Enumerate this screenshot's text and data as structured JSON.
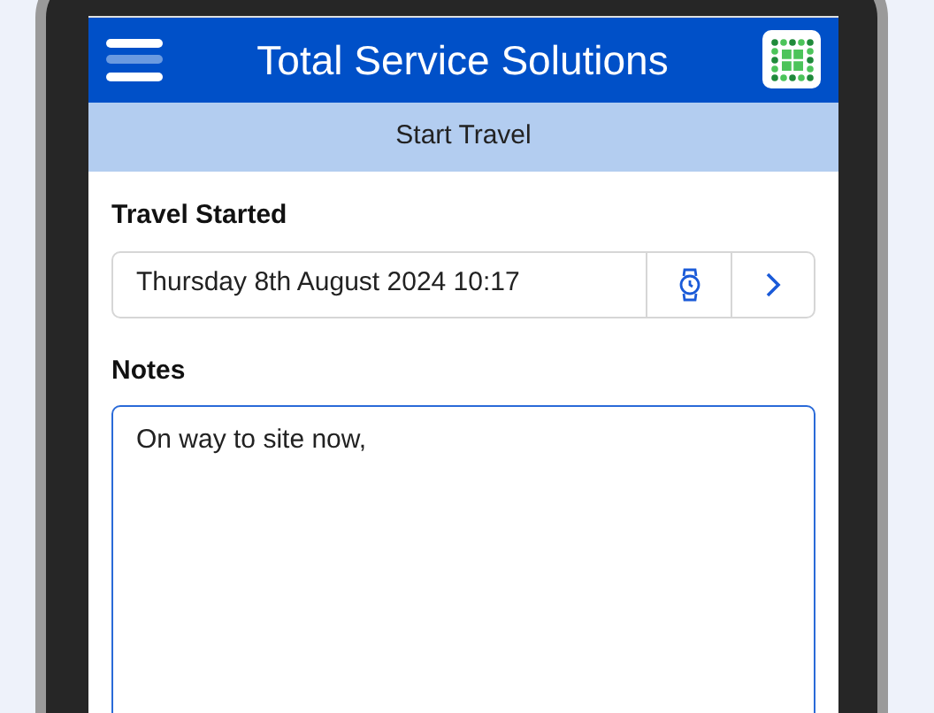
{
  "header": {
    "title": "Total Service Solutions"
  },
  "subheader": {
    "title": "Start Travel"
  },
  "travel_started": {
    "label": "Travel Started",
    "value": "Thursday 8th August 2024 10:17"
  },
  "notes": {
    "label": "Notes",
    "value": "On way to site now,"
  }
}
